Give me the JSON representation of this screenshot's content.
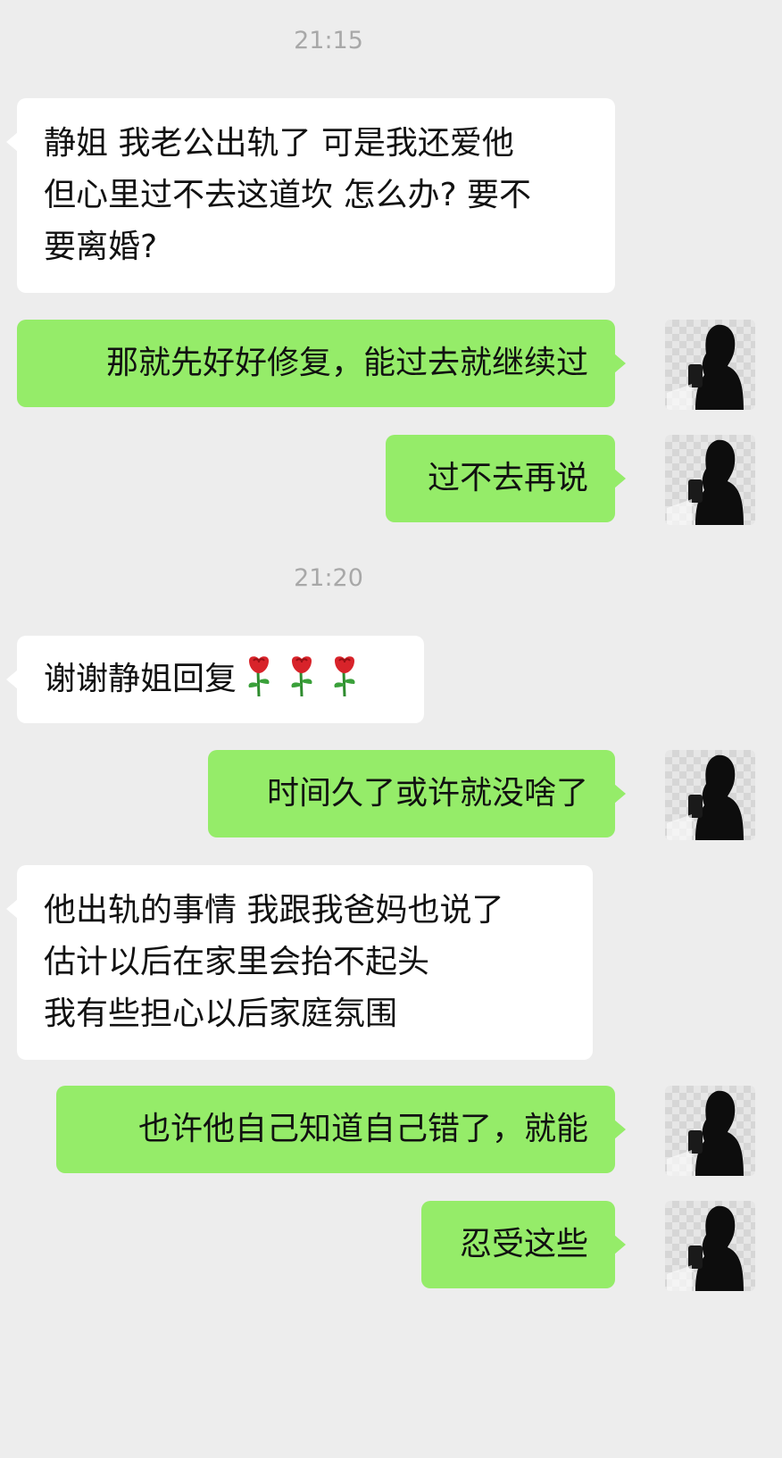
{
  "chat": {
    "timestamps": [
      "21:15",
      "21:20"
    ],
    "messages": [
      {
        "from": "incoming",
        "lines": [
          "静姐 我老公出轨了 可是我还爱他",
          "但心里过不去这道坎 怎么办? 要不",
          "要离婚?"
        ]
      },
      {
        "from": "outgoing",
        "lines": [
          "那就先好好修复，能过去就继续过"
        ]
      },
      {
        "from": "outgoing",
        "lines": [
          "过不去再说"
        ]
      },
      {
        "from": "incoming",
        "lines": [
          "谢谢静姐回复"
        ],
        "emoji": [
          "rose",
          "rose",
          "rose"
        ]
      },
      {
        "from": "outgoing",
        "lines": [
          "时间久了或许就没啥了"
        ]
      },
      {
        "from": "incoming",
        "lines": [
          "他出轨的事情 我跟我爸妈也说了",
          "估计以后在家里会抬不起头",
          "我有些担心以后家庭氛围"
        ]
      },
      {
        "from": "outgoing",
        "lines": [
          "也许他自己知道自己错了，就能"
        ]
      },
      {
        "from": "outgoing",
        "lines": [
          "忍受这些"
        ]
      }
    ]
  },
  "colors": {
    "background": "#ededed",
    "incoming_bubble": "#ffffff",
    "outgoing_bubble": "#95ec69",
    "timestamp": "#a8a8a8"
  },
  "icons": {
    "avatar": "silhouette-avatar-icon",
    "emoji": "rose-emoji-icon"
  }
}
